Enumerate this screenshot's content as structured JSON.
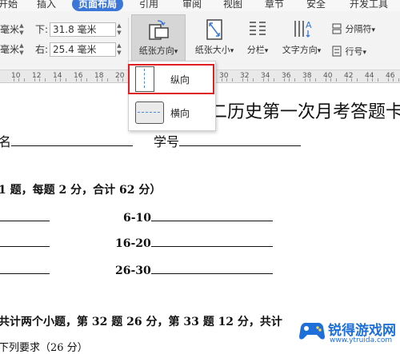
{
  "ribbon_tabs": [
    "开始",
    "插入",
    "页面布局",
    "引用",
    "审阅",
    "视图",
    "章节",
    "安全",
    "开发工具"
  ],
  "active_tab": "页面布局",
  "margins": {
    "top_partial": "毫米",
    "bottom_label": "下:",
    "bottom_value": "31.8 毫米",
    "left_partial": "毫米",
    "right_label": "右:",
    "right_value": "25.4 毫米"
  },
  "toolbar": {
    "orientation_label": "纸张方向",
    "size_label": "纸张大小",
    "columns_label": "分栏",
    "text_direction_label": "文字方向",
    "separator_label": "分隔符",
    "line_number_label": "行号"
  },
  "dropdown_caret": "▾",
  "ruler_numbers": [
    "10",
    "12",
    "14",
    "16",
    "18",
    "20",
    "22",
    "24",
    "26",
    "28",
    "30",
    "32",
    "34",
    "36",
    "38",
    "40",
    "42",
    "44",
    "46",
    "48"
  ],
  "orientation_menu": {
    "portrait_label": "纵向",
    "landscape_label": "横向"
  },
  "document": {
    "title": "二历史第一次月考答题卡",
    "name_label": "名",
    "student_id_label": "学号",
    "section1": "1 题，每题 2 分，合计 62 分）",
    "answer_6_10": "6-10",
    "answer_16_20": "16-20",
    "answer_26_30": "26-30",
    "section2": "共计两个小题，第 32 题 26 分，第 33 题 12 分，共计",
    "section2_sub": "下列要求（26 分）"
  },
  "watermark": {
    "text": "锐得游戏网",
    "url": "www.ytruida.com"
  },
  "colors": {
    "active_tab_bg": "#3a77d9",
    "highlight_border": "#e02020",
    "watermark_blue": "#1e6fd9"
  }
}
